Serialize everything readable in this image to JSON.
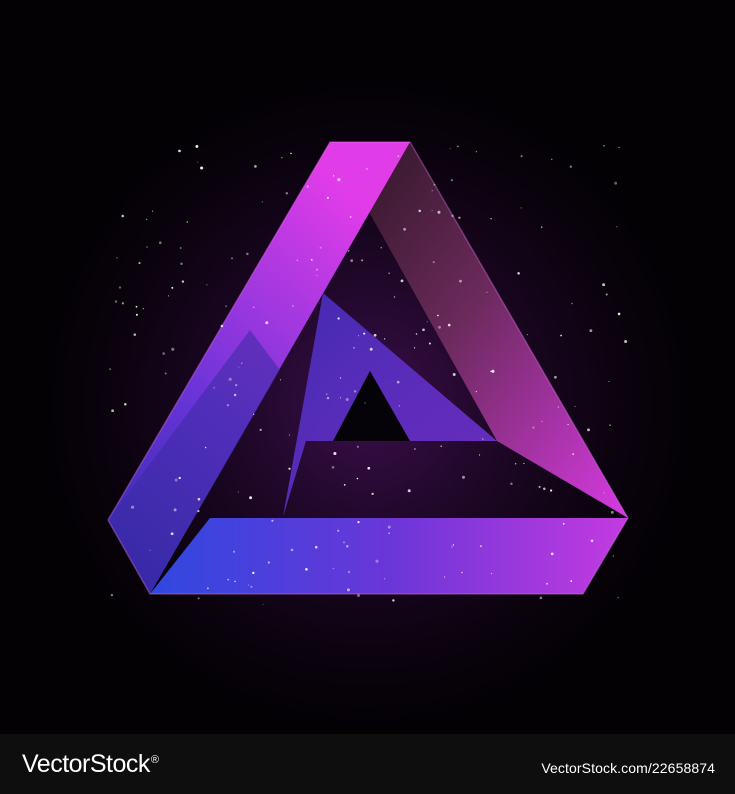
{
  "artwork": {
    "subject": "impossible-triangle",
    "palette": {
      "background": "#030104",
      "magenta": "#e23cf0",
      "violet": "#8a3ae0",
      "indigo": "#3a2cc8",
      "blue": "#2a4ae6",
      "dark_maroon": "#3a1a2a",
      "star": "#ffffff"
    }
  },
  "footer": {
    "brand": "VectorStock",
    "brand_mark": "®",
    "credit": "VectorStock.com/22658874",
    "background": "#0e0e0e"
  }
}
